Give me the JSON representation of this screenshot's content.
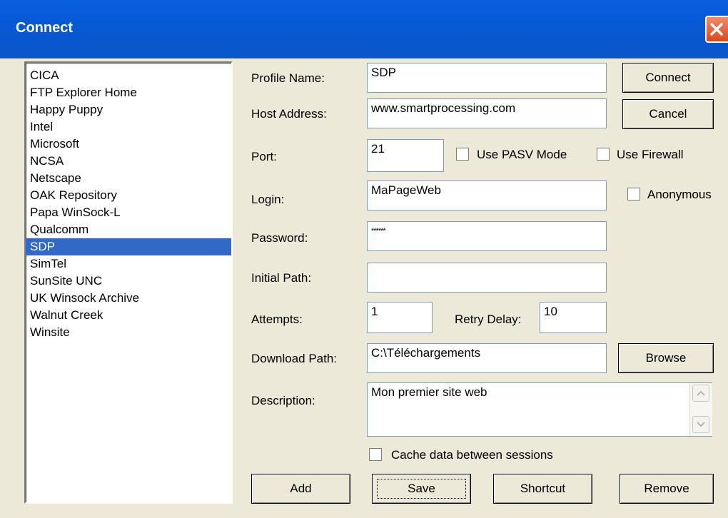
{
  "window": {
    "title": "Connect"
  },
  "profiles": {
    "items": [
      "CICA",
      "FTP Explorer Home",
      "Happy Puppy",
      "Intel",
      "Microsoft",
      "NCSA",
      "Netscape",
      "OAK Repository",
      "Papa WinSock-L",
      "Qualcomm",
      "SDP",
      "SimTel",
      "SunSite UNC",
      "UK Winsock Archive",
      "Walnut Creek",
      "Winsite"
    ],
    "selected": "SDP"
  },
  "form": {
    "profile_name": {
      "label": "Profile Name:",
      "value": "SDP"
    },
    "host_address": {
      "label": "Host Address:",
      "value": "www.smartprocessing.com"
    },
    "port": {
      "label": "Port:",
      "value": "21"
    },
    "use_pasv": {
      "label": "Use PASV Mode",
      "checked": false
    },
    "use_firewall": {
      "label": "Use Firewall",
      "checked": false
    },
    "login": {
      "label": "Login:",
      "value": "MaPageWeb"
    },
    "anonymous": {
      "label": "Anonymous",
      "checked": false
    },
    "password": {
      "label": "Password:",
      "value": "******"
    },
    "initial_path": {
      "label": "Initial Path:",
      "value": ""
    },
    "attempts": {
      "label": "Attempts:",
      "value": "1"
    },
    "retry_delay": {
      "label": "Retry Delay:",
      "value": "10"
    },
    "download_path": {
      "label": "Download Path:",
      "value": "C:\\Téléchargements"
    },
    "description": {
      "label": "Description:",
      "value": "Mon premier site web"
    },
    "cache": {
      "label": "Cache data between sessions",
      "checked": false
    }
  },
  "buttons": {
    "connect": "Connect",
    "cancel": "Cancel",
    "browse": "Browse",
    "add": "Add",
    "save": "Save",
    "shortcut": "Shortcut",
    "remove": "Remove"
  },
  "icons": {
    "close": "close-icon",
    "scroll_up": "scroll-up-arrow-icon",
    "scroll_down": "scroll-down-arrow-icon"
  },
  "colors": {
    "titlebar": "#0a5fdf",
    "selection": "#316ac5",
    "dialog_bg": "#ece9d8",
    "close_button": "#d8491f"
  }
}
